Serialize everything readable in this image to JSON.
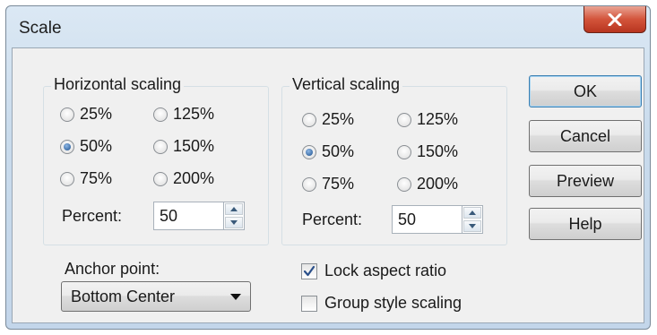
{
  "window": {
    "title": "Scale",
    "close_glyph": "X"
  },
  "horizontal": {
    "label": "Horizontal scaling",
    "options": [
      "25%",
      "125%",
      "50%",
      "150%",
      "75%",
      "200%"
    ],
    "selected": "50%",
    "percent_label": "Percent:",
    "percent_value": "50"
  },
  "vertical": {
    "label": "Vertical scaling",
    "options": [
      "25%",
      "125%",
      "50%",
      "150%",
      "75%",
      "200%"
    ],
    "selected": "50%",
    "percent_label": "Percent:",
    "percent_value": "50"
  },
  "anchor": {
    "label": "Anchor point:",
    "value": "Bottom Center"
  },
  "checks": {
    "lock_label": "Lock aspect ratio",
    "lock_checked": true,
    "group_label": "Group style scaling",
    "group_checked": false
  },
  "buttons": {
    "ok": "OK",
    "cancel": "Cancel",
    "preview": "Preview",
    "help": "Help"
  }
}
